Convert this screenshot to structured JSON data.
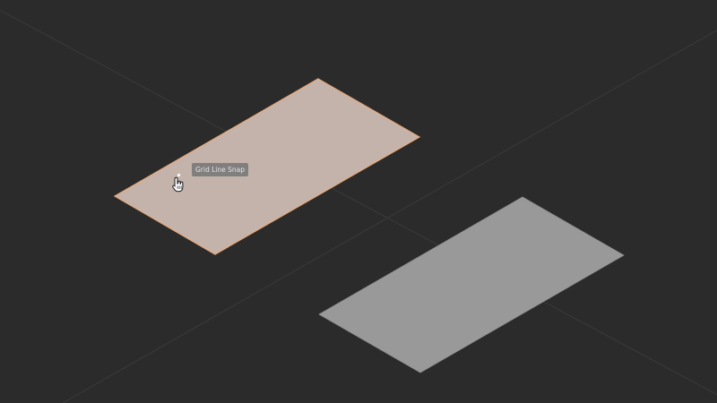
{
  "viewport": {
    "background": "#2b2b2b",
    "grid_line_color": "#3a3a3a"
  },
  "plane_selected": {
    "fill": "#c4b3ab",
    "outline": "#e8a97a",
    "state": "selected"
  },
  "plane_other": {
    "fill": "#999999",
    "state": "unselected"
  },
  "snap_tooltip": {
    "text": "Grid Line Snap"
  },
  "cursor": {
    "icon": "hand-pointer-icon"
  }
}
